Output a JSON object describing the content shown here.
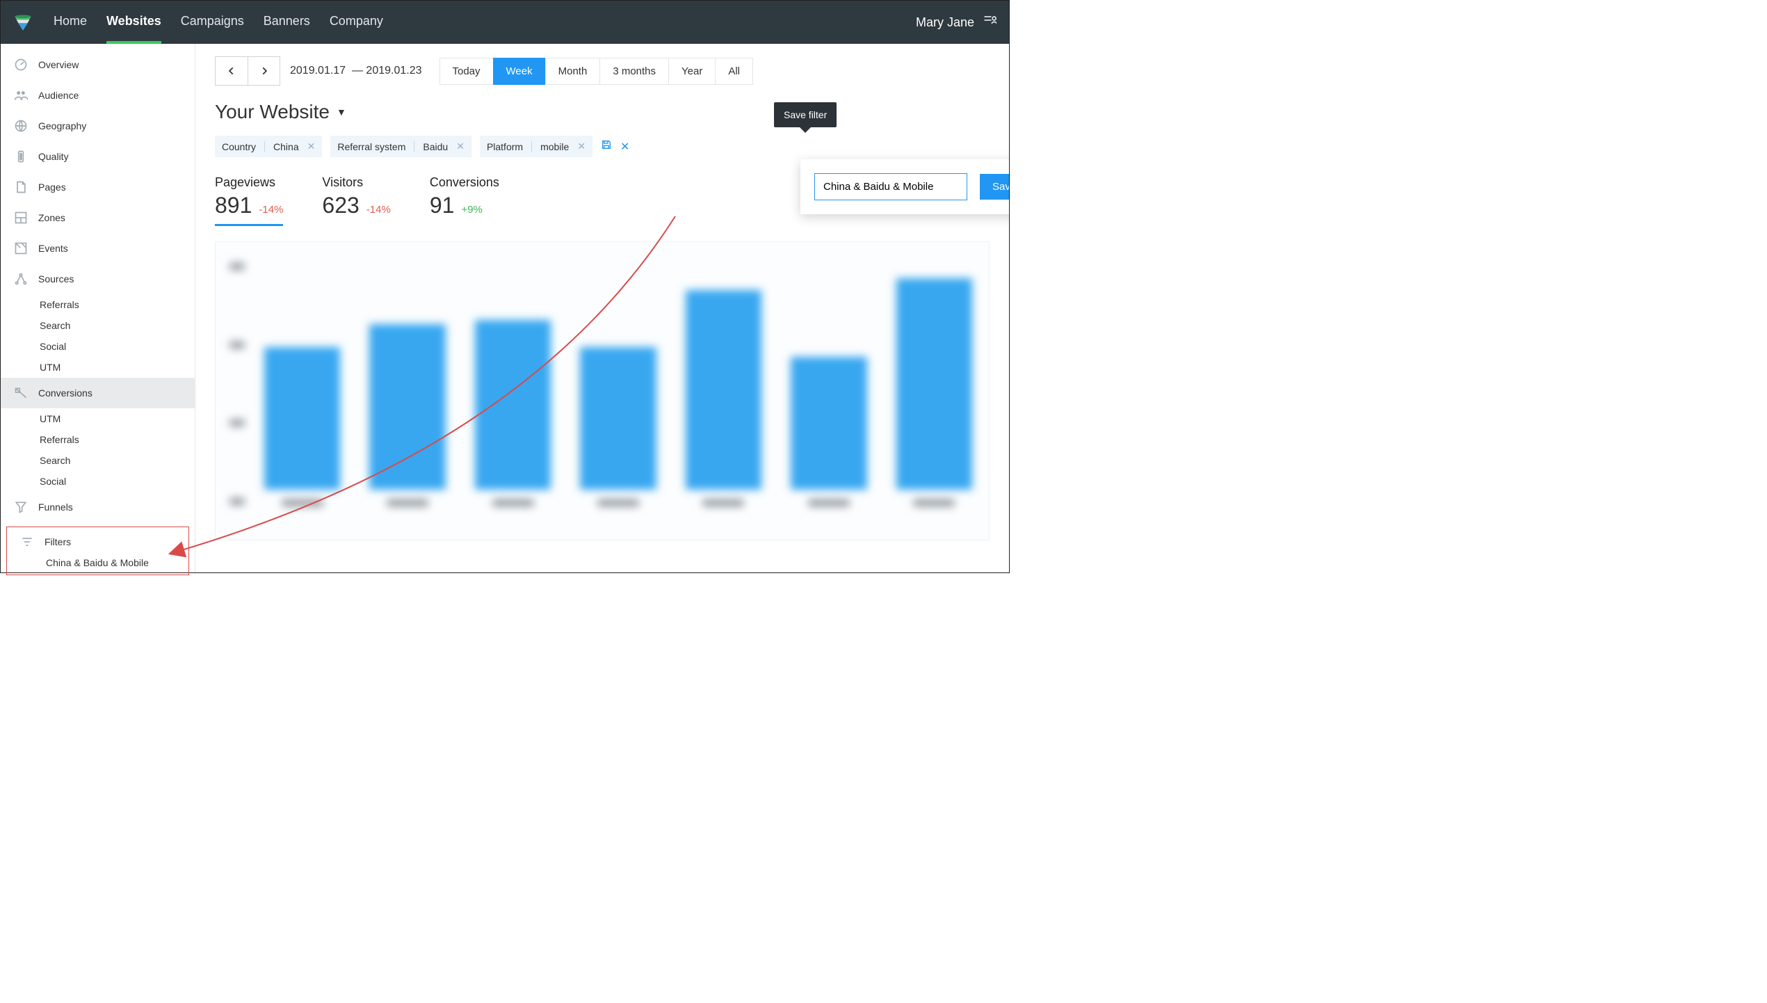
{
  "header": {
    "nav": [
      "Home",
      "Websites",
      "Campaigns",
      "Banners",
      "Company"
    ],
    "active_nav": "Websites",
    "user_name": "Mary Jane"
  },
  "sidebar": {
    "items": [
      {
        "icon": "overview",
        "label": "Overview"
      },
      {
        "icon": "audience",
        "label": "Audience"
      },
      {
        "icon": "geography",
        "label": "Geography"
      },
      {
        "icon": "quality",
        "label": "Quality"
      },
      {
        "icon": "pages",
        "label": "Pages"
      },
      {
        "icon": "zones",
        "label": "Zones"
      },
      {
        "icon": "events",
        "label": "Events"
      },
      {
        "icon": "sources",
        "label": "Sources"
      },
      {
        "icon": "conversions",
        "label": "Conversions"
      },
      {
        "icon": "funnels",
        "label": "Funnels"
      },
      {
        "icon": "filters",
        "label": "Filters"
      }
    ],
    "sources_sub": [
      "Referrals",
      "Search",
      "Social",
      "UTM"
    ],
    "conversions_sub": [
      "UTM",
      "Referrals",
      "Search",
      "Social"
    ],
    "filters_sub": [
      "China & Baidu & Mobile"
    ],
    "selected": "Conversions"
  },
  "main": {
    "date_from": "2019.01.17",
    "date_to": "2019.01.23",
    "range_tabs": [
      "Today",
      "Week",
      "Month",
      "3 months",
      "Year",
      "All"
    ],
    "range_active": "Week",
    "site_title": "Your Website",
    "filters": [
      {
        "label": "Country",
        "value": "China"
      },
      {
        "label": "Referral system",
        "value": "Baidu"
      },
      {
        "label": "Platform",
        "value": "mobile"
      }
    ],
    "tooltip_text": "Save filter",
    "save_input_value": "China & Baidu & Mobile",
    "save_button_label": "Save",
    "metrics": [
      {
        "label": "Pageviews",
        "value": "891",
        "delta": "-14%",
        "dir": "neg",
        "active": true
      },
      {
        "label": "Visitors",
        "value": "623",
        "delta": "-14%",
        "dir": "neg"
      },
      {
        "label": "Conversions",
        "value": "91",
        "delta": "+9%",
        "dir": "pos"
      }
    ]
  },
  "chart_data": {
    "type": "bar",
    "note": "Axis tick labels and category labels are blurred/illegible in the source image; values below are approximate relative bar heights on a 0–100 scale.",
    "categories": [
      "d1",
      "d2",
      "d3",
      "d4",
      "d5",
      "d6",
      "d7"
    ],
    "values": [
      62,
      72,
      74,
      62,
      87,
      58,
      92
    ],
    "ylim": [
      0,
      100
    ]
  }
}
